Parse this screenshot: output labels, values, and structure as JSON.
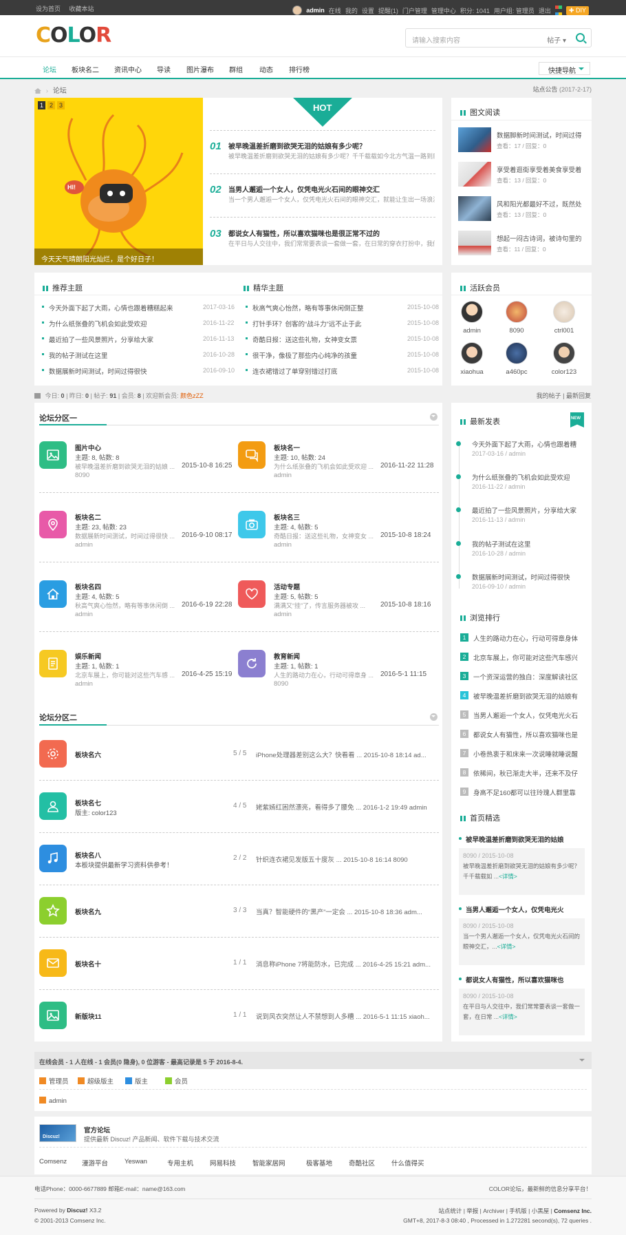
{
  "topbar": {
    "set_home": "设为首页",
    "bookmark": "收藏本站",
    "username": "admin",
    "status": "在线",
    "my": "我的",
    "settings": "设置",
    "reminder": "提醒(1)",
    "portal_admin": "门户管理",
    "admin_center": "管理中心",
    "points": "积分: 1041",
    "usergroup": "用户组: 管理员",
    "logout": "退出",
    "diy": "DIY"
  },
  "header": {
    "logo": "COLOR",
    "search_placeholder": "请输入搜索内容",
    "search_type": "帖子"
  },
  "nav": {
    "items": [
      "论坛",
      "板块名二",
      "资讯中心",
      "导读",
      "图片瀑布",
      "群组",
      "动态",
      "排行榜"
    ],
    "quick_nav": "快捷导航"
  },
  "breadcrumb": {
    "current": "论坛"
  },
  "notice": {
    "label": "站点公告",
    "date": "(2017-2-17)"
  },
  "slider": {
    "pages": [
      "1",
      "2",
      "3"
    ],
    "caption": "今天天气晴朗阳光灿烂，是个好日子！",
    "badge": "HI!"
  },
  "hot": {
    "label": "HOT",
    "items": [
      {
        "num": "01",
        "title": "被早晚温差折磨到欲哭无泪的姑娘有多少呢？",
        "desc": "被早晚温差折磨到欲哭无泪的姑娘有多少呢？千千载载如今北方气温一路到底可谓..."
      },
      {
        "num": "02",
        "title": "当男人邂逅一个女人，仅凭电光火石间的眼神交汇",
        "desc": "当一个男人邂逅一个女人，仅凭电光火石间的眼神交汇，就能让生出一场浪漫..."
      },
      {
        "num": "03",
        "title": "都说女人有猫性，所以喜欢猫咪也是很正常不过的",
        "desc": "在平日与人交往中，我们常常要表谈一套做一套，在日常的穿衣打扮中，我们也..."
      }
    ]
  },
  "pic_read": {
    "title": "图文阅读",
    "items": [
      {
        "title": "数据脚新时间测试，时间过得",
        "meta": "查看：17  /  回复：0"
      },
      {
        "title": "享受着逛街享受着美食享受着",
        "meta": "查看：13  /  回复：0"
      },
      {
        "title": "风和阳光都最好不过，既然处",
        "meta": "查看：13  /  回复：0"
      },
      {
        "title": "想起一闷古诗词，被诗句里的",
        "meta": "查看：11  /  回复：0"
      }
    ]
  },
  "recommend": {
    "title": "推荐主题",
    "items": [
      {
        "t": "今天外面下起了大雨，心情也跟着糟糕起来",
        "d": "2017-03-16"
      },
      {
        "t": "为什么纸张叠的飞机会如此受欢迎",
        "d": "2016-11-22"
      },
      {
        "t": "最近拍了一些风景照片，分享给大家",
        "d": "2016-11-13"
      },
      {
        "t": "我的帖子测试在这里",
        "d": "2016-10-28"
      },
      {
        "t": "数据展新时间测试，时间过得很快",
        "d": "2016-09-10"
      }
    ]
  },
  "digest": {
    "title": "精华主题",
    "items": [
      {
        "t": "秋高气爽心怡然，略有等事休闲倒正整",
        "d": "2015-10-08"
      },
      {
        "t": "打针手环？创客的“战斗力”远不止于此",
        "d": "2015-10-08"
      },
      {
        "t": "奇酷日报：送这些礼物，女神变女票",
        "d": "2015-10-08"
      },
      {
        "t": "很干净，像极了那些内心纯净的孩童",
        "d": "2015-10-08"
      },
      {
        "t": "连衣裙错过了单穿别错过打底",
        "d": "2015-10-08"
      }
    ]
  },
  "members": {
    "title": "活跃会员",
    "items": [
      "admin",
      "8090",
      "ctrl001",
      "xiaohua",
      "a460pc",
      "color123"
    ]
  },
  "stats": {
    "today_label": "今日:",
    "today": "0",
    "yesterday_label": "昨日:",
    "yesterday": "0",
    "posts_label": "帖子:",
    "posts": "91",
    "members_label": "会员:",
    "members": "8",
    "newest_label": "欢迎新会员:",
    "newest": "颜色zZZ",
    "my_posts": "我的帖子",
    "latest_reply": "最新回复"
  },
  "forum1": {
    "title": "论坛分区一",
    "boards": [
      {
        "name": "图片中心",
        "meta": "主题: 8, 帖数: 8",
        "last": "被早晚温差折磨到欲哭无泪的姑娘 ...",
        "time": "2015-10-8 16:25",
        "user": "8090",
        "color": "#2ebd85",
        "icon": "image-icon"
      },
      {
        "name": "板块名一",
        "meta": "主题: 10, 帖数: 24",
        "last": "为什么纸张叠的飞机会如此受欢迎 ...",
        "time": "2016-11-22 11:28",
        "user": "admin",
        "color": "#f39c12",
        "icon": "chat-icon"
      },
      {
        "name": "板块名二",
        "meta": "主题: 23, 帖数: 23",
        "last": "数据展新时间测试，时间过得很快 ...",
        "time": "2016-9-10 08:17",
        "user": "admin",
        "color": "#e85aa8",
        "icon": "location-icon"
      },
      {
        "name": "板块名三",
        "meta": "主题: 4, 帖数: 5",
        "last": "奇酷日报：送这些礼物，女神变女 ...",
        "time": "2015-10-8 18:24",
        "user": "admin",
        "color": "#3ec8ea",
        "icon": "camera-icon"
      },
      {
        "name": "板块名四",
        "meta": "主题: 4, 帖数: 5",
        "last": "秋高气爽心怡然，略有等事休闲倒 ...",
        "time": "2016-6-19 22:28",
        "user": "admin",
        "color": "#2a9de2",
        "icon": "home-icon"
      },
      {
        "name": "活动专题",
        "meta": "主题: 5, 帖数: 5",
        "last": "满满又“挂”了，传言服务器被攻 ...",
        "time": "2015-10-8 18:16",
        "user": "admin",
        "color": "#ef5a5a",
        "icon": "heart-icon"
      },
      {
        "name": "娱乐新闻",
        "meta": "主题: 1, 帖数: 1",
        "last": "北京车展上，你可能对这些汽车感 ...",
        "time": "2016-4-25 15:19",
        "user": "admin",
        "color": "#f6c922",
        "icon": "document-icon"
      },
      {
        "name": "教育新闻",
        "meta": "主题: 1, 帖数: 1",
        "last": "人生的路动力在心，行动可得章身 ...",
        "time": "2016-5-1 11:15",
        "user": "8090",
        "color": "#8b7fd0",
        "icon": "refresh-icon"
      }
    ]
  },
  "forum2": {
    "title": "论坛分区二",
    "boards": [
      {
        "name": "板块名六",
        "desc": "",
        "count": "5 / 5",
        "last": "iPhone处理器差别这么大？快看看 ... 2015-10-8 18:14 ad...",
        "color": "#f26a50",
        "icon": "gear-icon"
      },
      {
        "name": "板块名七",
        "desc": "版主: color123",
        "count": "4 / 5",
        "last": "姥紫嫣红困然漂亮，看得多了腰免 ... 2016-1-2 19:49 admin",
        "color": "#23bfa4",
        "icon": "users-icon"
      },
      {
        "name": "板块名八",
        "desc": "本板块提供最新学习资料供参考！",
        "count": "2 / 2",
        "last": "针织连衣裙见发版五十度灰 ... 2015-10-8 16:14 8090",
        "color": "#2d8ee0",
        "icon": "music-icon"
      },
      {
        "name": "板块名九",
        "desc": "",
        "count": "3 / 3",
        "last": "当真？智能硬件的“黑产”一定会 ... 2015-10-8 18:36 adm...",
        "color": "#8ccf2e",
        "icon": "star-icon"
      },
      {
        "name": "板块名十",
        "desc": "",
        "count": "1 / 1",
        "last": "消息称iPhone 7将能防水，已完成 ... 2016-4-25 15:21 adm...",
        "color": "#f7b918",
        "icon": "mail-icon"
      },
      {
        "name": "新版块11",
        "desc": "",
        "count": "1 / 1",
        "last": "说到风衣突然让人不禁想到人多糟 ... 2016-5-1 11:15 xiaoh...",
        "color": "#2ebd85",
        "icon": "image-icon"
      }
    ]
  },
  "latest_posts": {
    "title": "最新发表",
    "badge": "NEW",
    "items": [
      {
        "t": "今天外面下起了大雨，心情也跟着糟",
        "m": "2017-03-16 / admin"
      },
      {
        "t": "为什么纸张叠的飞机会如此受欢迎",
        "m": "2016-11-22 / admin"
      },
      {
        "t": "最近拍了一些风景照片，分享给大家",
        "m": "2016-11-13 / admin"
      },
      {
        "t": "我的帖子测试在这里",
        "m": "2016-10-28 / admin"
      },
      {
        "t": "数据展新时间测试，时间过得很快",
        "m": "2016-09-10 / admin"
      }
    ]
  },
  "ranking": {
    "title": "浏览排行",
    "items": [
      "人生的路动力在心，行动可得章身体",
      "北京车展上，你可能对这些汽车感兴",
      "一个资深运营的独白：深度解读社区",
      "被早晚温差折磨到欲哭无泪的姑娘有",
      "当男人邂逅一个女人，仅凭电光火石",
      "都说女人有猫性，所以喜欢猫咪也是",
      "小卷热衷于和床来一次说睡就睡说醒",
      "依稀间，秋已渐走大半，还来不及仔",
      "身高不足160都可以往玲瑰人群里靠"
    ]
  },
  "picks": {
    "title": "首页精选",
    "items": [
      {
        "t": "被早晚温差折磨到欲哭无泪的姑娘",
        "m": "8090 / 2015-10-08",
        "d": "被早晚温差折磨到欲哭无泪的姑娘有多少呢？千千载载如 ...",
        "more": "<详情>"
      },
      {
        "t": "当男人邂逅一个女人，仅凭电光火",
        "m": "8090 / 2015-10-08",
        "d": "当一个男人邂逅一个女人，仅凭电光火石间的眼神交汇，...",
        "more": "<详情>"
      },
      {
        "t": "都说女人有猫性，所以喜欢猫咪也",
        "m": "8090 / 2015-10-08",
        "d": "在平日与人交往中，我们常常要表谈一套做一套，在日常 ...",
        "more": "<详情>"
      }
    ]
  },
  "online": {
    "title": "在线会员 - 1 人在线 - 1 会员(0 隐身), 0 位游客 - 最高记录是 5 于 2016-8-4.",
    "legend": [
      "管理员",
      "超级版主",
      "版主",
      "会员"
    ],
    "legend_colors": [
      "#f08a24",
      "#f08a24",
      "#2d8ee0",
      "#8ccf2e"
    ],
    "users": [
      "admin"
    ]
  },
  "friend_links": {
    "official_badge": "Discuz!",
    "official_title": "官方论坛",
    "official_desc": "提供最新 Discuz! 产品新闻、软件下载与技术交流",
    "items": [
      "Comsenz",
      "漫游平台",
      "Yeswan",
      "专用主机",
      "网易科技",
      "智能家居网",
      "极客基地",
      "奇酷社区",
      "什么值得买"
    ]
  },
  "footer": {
    "contact": "电话Phone：0000-6677889    邮箱E-mail：name@163.com",
    "slogan": "COLOR论坛，最新鲜的信息分享平台！",
    "powered": "Powered by",
    "brand": "Discuz!",
    "version": "X3.2",
    "copyright": "© 2001-2013 Comsenz Inc.",
    "links": "站点统计 | 举报 | Archiver | 手机版 | 小黑屋 |",
    "company": "Comsenz Inc.",
    "runtime": "GMT+8, 2017-8-3 08:40 , Processed in 1.272281 second(s), 72 queries ."
  }
}
